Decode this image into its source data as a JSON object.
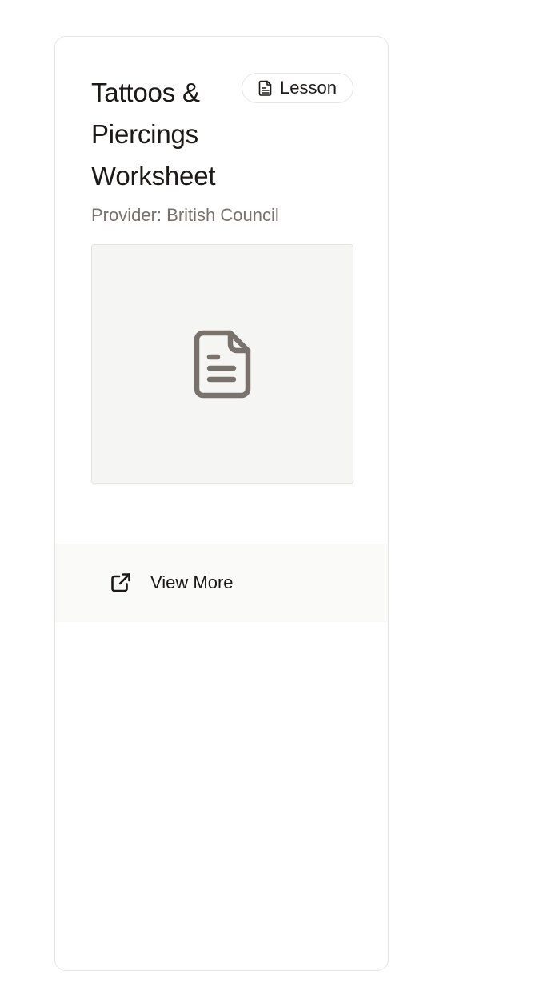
{
  "card": {
    "title": "Tattoos & Piercings Worksheet",
    "badge": {
      "label": "Lesson",
      "icon": "document-icon"
    },
    "provider": "Provider: British Council",
    "preview": {
      "icon": "document-icon"
    },
    "footer": {
      "action_label": "View More",
      "action_icon": "external-link-icon"
    }
  },
  "colors": {
    "text_primary": "#1c1917",
    "text_muted": "#78716c",
    "border": "#e7e5e4",
    "preview_bg": "#f5f5f4",
    "preview_icon": "#78716c",
    "footer_bg": "#fafaf9"
  }
}
